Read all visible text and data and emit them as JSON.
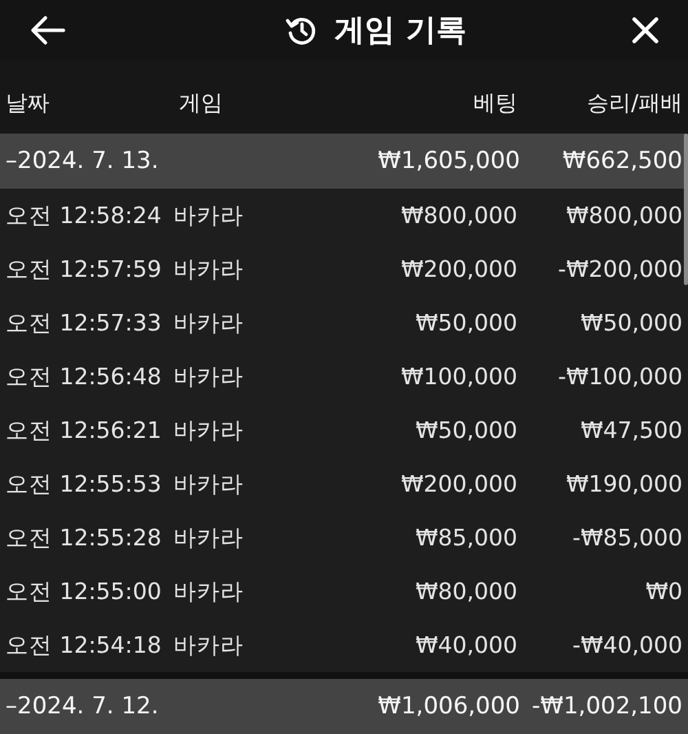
{
  "header": {
    "title": "게임 기록"
  },
  "columns": [
    "날짜",
    "게임",
    "베팅",
    "승리/패배"
  ],
  "groups": [
    {
      "date": "–2024. 7. 13.",
      "bet": "₩1,605,000",
      "result": "₩662,500",
      "rows": [
        {
          "time": "오전 12:58:24",
          "game": "바카라",
          "bet": "₩800,000",
          "result": "₩800,000"
        },
        {
          "time": "오전 12:57:59",
          "game": "바카라",
          "bet": "₩200,000",
          "result": "-₩200,000"
        },
        {
          "time": "오전 12:57:33",
          "game": "바카라",
          "bet": "₩50,000",
          "result": "₩50,000"
        },
        {
          "time": "오전 12:56:48",
          "game": "바카라",
          "bet": "₩100,000",
          "result": "-₩100,000"
        },
        {
          "time": "오전 12:56:21",
          "game": "바카라",
          "bet": "₩50,000",
          "result": "₩47,500"
        },
        {
          "time": "오전 12:55:53",
          "game": "바카라",
          "bet": "₩200,000",
          "result": "₩190,000"
        },
        {
          "time": "오전 12:55:28",
          "game": "바카라",
          "bet": "₩85,000",
          "result": "-₩85,000"
        },
        {
          "time": "오전 12:55:00",
          "game": "바카라",
          "bet": "₩80,000",
          "result": "₩0"
        },
        {
          "time": "오전 12:54:18",
          "game": "바카라",
          "bet": "₩40,000",
          "result": "-₩40,000"
        }
      ]
    },
    {
      "date": "–2024. 7. 12.",
      "bet": "₩1,006,000",
      "result": "-₩1,002,100"
    }
  ]
}
